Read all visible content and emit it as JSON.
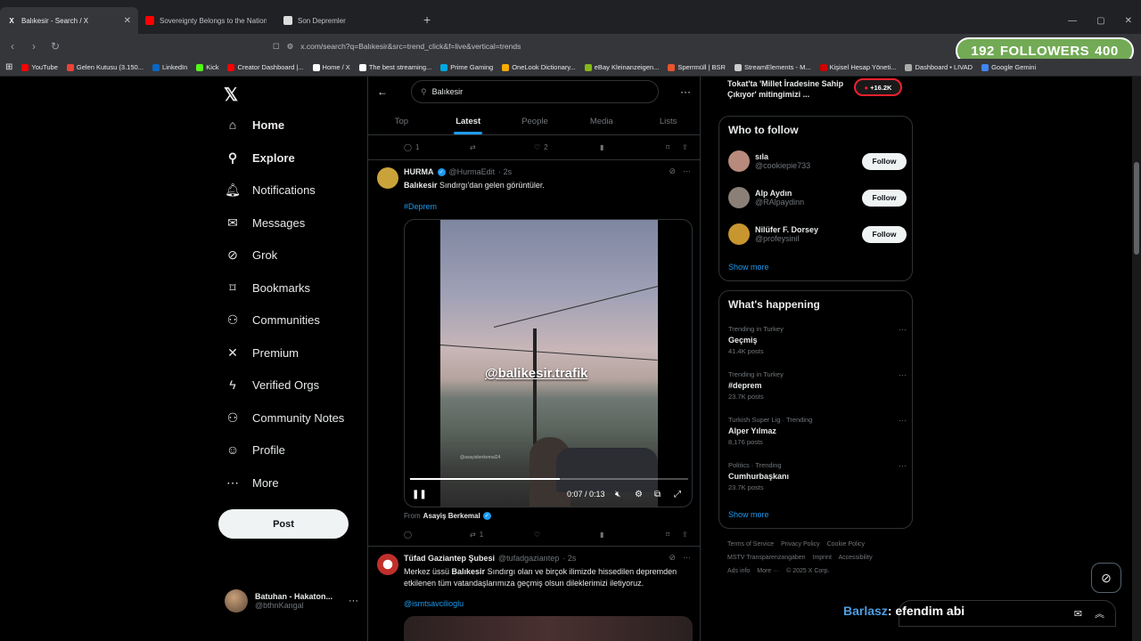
{
  "browser": {
    "tabs": [
      {
        "title": "Balıkesir - Search / X",
        "active": true
      },
      {
        "title": "Sovereignty Belongs to the Nation U",
        "active": false
      },
      {
        "title": "Son Depremler",
        "active": false
      }
    ],
    "url": "x.com/search?q=Balıkesir&src=trend_click&f=live&vertical=trends",
    "bookmarks": [
      "YouTube",
      "Gelen Kutusu (3.150...",
      "LinkedIn",
      "Kick",
      "Creator Dashboard |...",
      "Home / X",
      "The best streaming...",
      "Prime Gaming",
      "OneLook Dictionary...",
      "eBay Kleinanzeigen...",
      "Sperrmüll | BSR",
      "StreamElements - M...",
      "Kişisel Hesap Yöneti...",
      "Dashboard • LIVAD",
      "Google Gemini"
    ]
  },
  "followers_overlay": {
    "current": "192",
    "label": "FOLLOWERS",
    "goal": "400"
  },
  "nav": {
    "items": [
      "Home",
      "Explore",
      "Notifications",
      "Messages",
      "Grok",
      "Bookmarks",
      "Communities",
      "Premium",
      "Verified Orgs",
      "Community Notes",
      "Profile",
      "More"
    ],
    "post_label": "Post",
    "account": {
      "name": "Batuhan - Hakaton...",
      "handle": "@bthnKangal"
    }
  },
  "search": {
    "query": "Balıkesir",
    "tabs": [
      "Top",
      "Latest",
      "People",
      "Media",
      "Lists"
    ],
    "active_tab": "Latest"
  },
  "prev_tweet_actions": {
    "replies": "1",
    "reposts": "",
    "likes": "2"
  },
  "tweet1": {
    "name": "HURMA",
    "handle": "@HurmaEdit",
    "time": "· 2s",
    "text_bold": "Balıkesir",
    "text_rest": " Sındırgı'dan gelen görüntüler.",
    "hashtag": "#Deprem",
    "video": {
      "watermark": "@balikesir.trafik",
      "small_watermark": "@asayisberkemal24",
      "time": "0:07 / 0:13",
      "progress": 0.54
    },
    "from_label": "From",
    "from_name": "Asayiş Berkemal",
    "actions": {
      "replies": "",
      "reposts": "1",
      "likes": ""
    }
  },
  "tweet2": {
    "name": "Tüfad Gaziantep Şubesi",
    "handle": "@tufadgaziantep",
    "time": "· 2s",
    "text_pre": "Merkez üssü ",
    "text_bold": "Balıkesir",
    "text_rest": " Sındırgı olan ve birçok ilimizde hissedilen depremden etkilenen tüm vatandaşlarımıza geçmiş olsun dileklerimizi iletiyoruz.",
    "link": "@ismtsavcilioglu"
  },
  "right": {
    "top_trend": "Tokat'ta 'Millet İradesine Sahip Çıkıyor' mitingimizi ...",
    "live_count": "+16.2K",
    "who_to_follow": {
      "title": "Who to follow",
      "people": [
        {
          "name": "sıla",
          "handle": "@cookiepie733"
        },
        {
          "name": "Alp Aydın",
          "handle": "@RAlpaydinn"
        },
        {
          "name": "Nilüfer F. Dorsey",
          "handle": "@profeysinil"
        }
      ],
      "follow_label": "Follow",
      "show_more": "Show more"
    },
    "happening": {
      "title": "What's happening",
      "trends": [
        {
          "context": "Trending in Turkey",
          "name": "Geçmiş",
          "count": "41.4K posts"
        },
        {
          "context": "Trending in Turkey",
          "name": "#deprem",
          "count": "23.7K posts"
        },
        {
          "context": "Turkish Super Lig · Trending",
          "name": "Alper Yılmaz",
          "count": "8,176 posts"
        },
        {
          "context": "Politics · Trending",
          "name": "Cumhurbaşkanı",
          "count": "23.7K posts"
        }
      ],
      "show_more": "Show more"
    },
    "footer": [
      "Terms of Service",
      "Privacy Policy",
      "Cookie Policy",
      "MSTV Transparenzangaben",
      "Imprint",
      "Accessibility",
      "Ads info",
      "More ···",
      "© 2025 X Corp."
    ]
  },
  "chat_overlay": {
    "user": "Barlasz",
    "message": ": efendim abi"
  },
  "colors": {
    "accent": "#1d9bf0",
    "background": "#000000",
    "border": "#2f3336",
    "live": "#f4212e"
  }
}
